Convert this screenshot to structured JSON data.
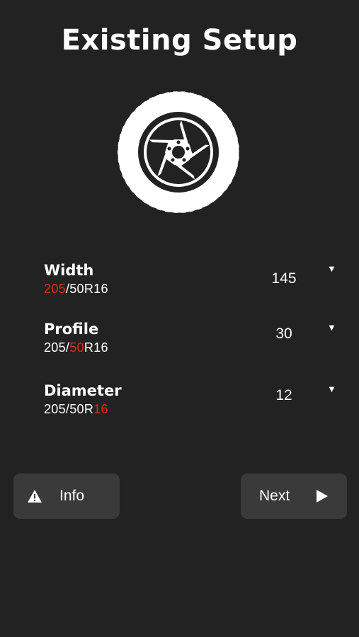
{
  "header": {
    "title": "Existing Setup"
  },
  "image": {
    "icon": "tire-wheel-icon"
  },
  "fields": {
    "width": {
      "label": "Width",
      "spec_highlight": "205",
      "spec_rest": "/50R16",
      "value": "145"
    },
    "profile": {
      "label": "Profile",
      "spec_before": "205/",
      "spec_highlight": "50",
      "spec_after": "R16",
      "value": "30"
    },
    "diameter": {
      "label": "Diameter",
      "spec_before": "205/50R",
      "spec_highlight": "16",
      "value": "12"
    }
  },
  "buttons": {
    "info_label": "Info",
    "next_label": "Next"
  },
  "colors": {
    "background": "#222222",
    "button_bg": "#3a3a3a",
    "highlight": "#e0281f",
    "text": "#ffffff"
  }
}
